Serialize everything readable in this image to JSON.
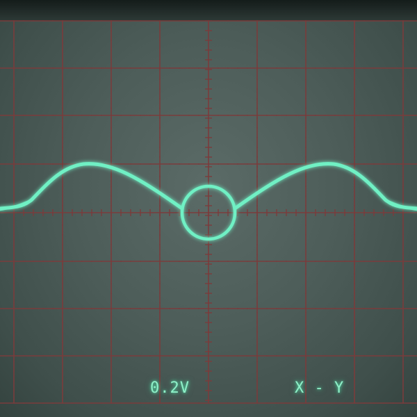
{
  "readout": {
    "volts_per_div": "0.2V",
    "mode": "X - Y"
  },
  "colors": {
    "screen": "#4f5f5b",
    "graticule": "#7a3c3c",
    "trace": "#6ff0c4"
  },
  "icons": {
    "trace": "lissajous-trace-icon"
  }
}
